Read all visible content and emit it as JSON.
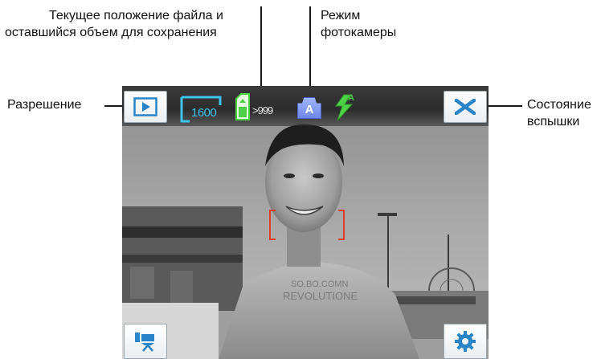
{
  "callouts": {
    "file_position": {
      "line1": "Текущее положение файла и",
      "line2": "оставшийся объем для сохранения"
    },
    "camera_mode": {
      "line1": "Режим",
      "line2": "фотокамеры"
    },
    "resolution": {
      "label": "Разрешение"
    },
    "flash_state": {
      "line1": "Состояние",
      "line2": "вспышки"
    }
  },
  "viewfinder": {
    "resolution_value": "1600",
    "remaining_shots": ">999",
    "mode_letter": "A",
    "flash_letter": "A",
    "icons": {
      "playback": "play-icon",
      "resolution": "resolution-frame-icon",
      "storage": "storage-card-icon",
      "mode": "camera-mode-icon",
      "flash": "flash-auto-icon",
      "close": "close-icon",
      "video": "video-camera-icon",
      "settings": "gear-icon",
      "focus": "focus-bracket-icon"
    }
  },
  "colors": {
    "accent_blue": "#3ec3f0",
    "button_icon_blue": "#2a84c8",
    "flash_green": "#4dd247",
    "focus_red": "#e23d2a",
    "mode_badge": "#7e97f0"
  }
}
